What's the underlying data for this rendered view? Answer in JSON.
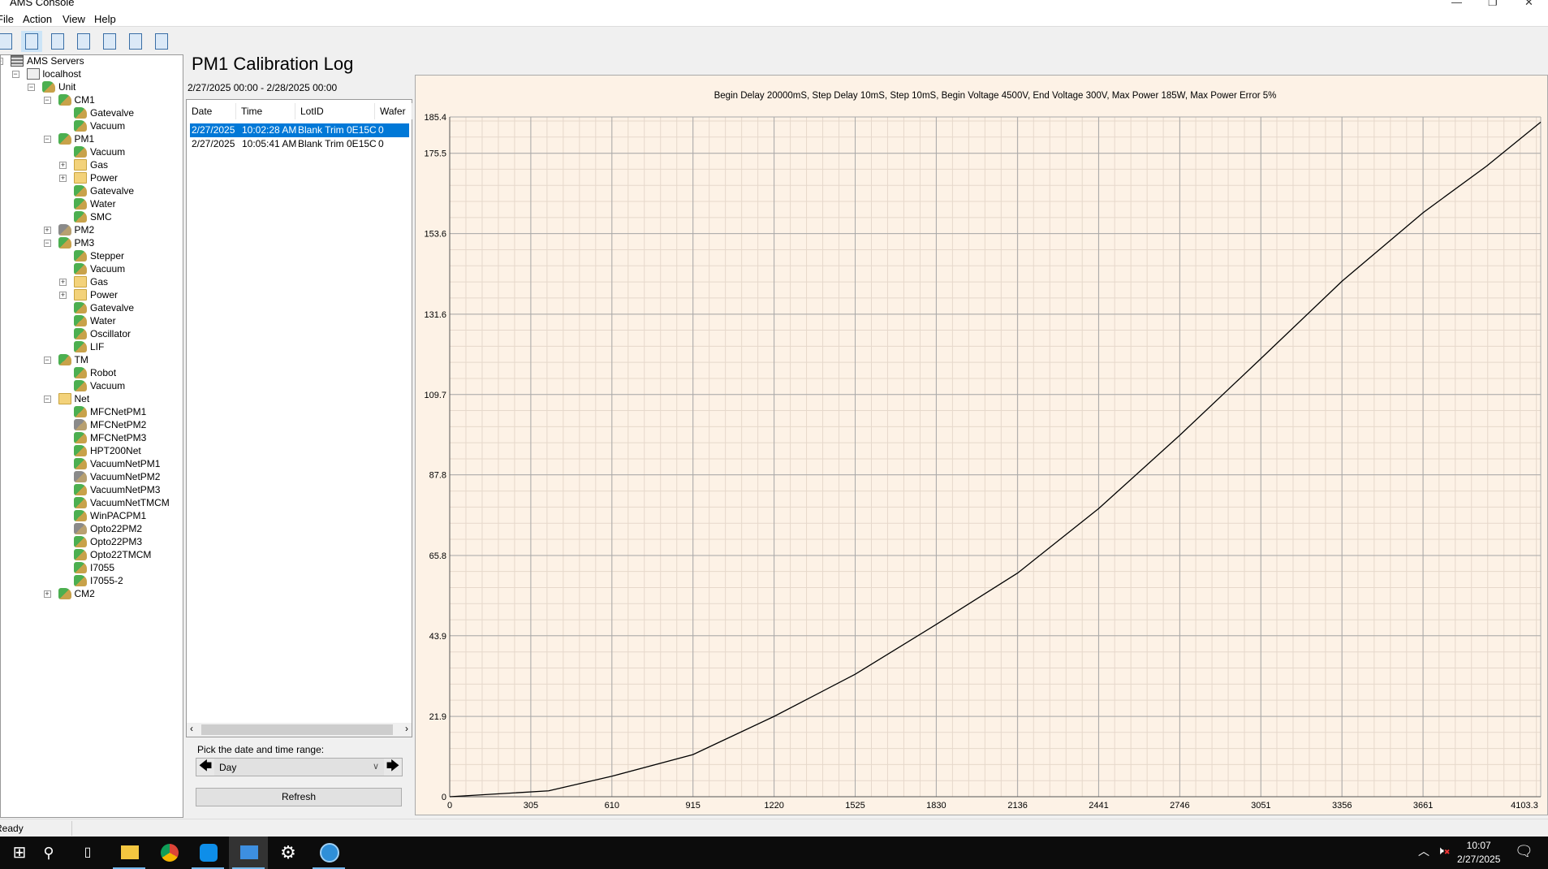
{
  "window": {
    "title": "AMS Console"
  },
  "menu": [
    "File",
    "Action",
    "View",
    "Help"
  ],
  "toolbar": [
    "alert-icon",
    "sync-icon",
    "check-icon",
    "help-info-icon",
    "document-icon",
    "edit-icon",
    "waveform-icon"
  ],
  "tree": [
    {
      "label": "AMS Servers",
      "level": 0,
      "icon": "server",
      "exp": "-"
    },
    {
      "label": "localhost",
      "level": 1,
      "icon": "host",
      "exp": "-"
    },
    {
      "label": "Unit",
      "level": 2,
      "icon": "dev",
      "exp": "-"
    },
    {
      "label": "CM1",
      "level": 3,
      "icon": "dev",
      "exp": "-"
    },
    {
      "label": "Gatevalve",
      "level": 4,
      "icon": "dev"
    },
    {
      "label": "Vacuum",
      "level": 4,
      "icon": "dev"
    },
    {
      "label": "PM1",
      "level": 3,
      "icon": "dev",
      "exp": "-"
    },
    {
      "label": "Vacuum",
      "level": 4,
      "icon": "dev"
    },
    {
      "label": "Gas",
      "level": 4,
      "icon": "folder",
      "exp": "+"
    },
    {
      "label": "Power",
      "level": 4,
      "icon": "folder",
      "exp": "+"
    },
    {
      "label": "Gatevalve",
      "level": 4,
      "icon": "dev"
    },
    {
      "label": "Water",
      "level": 4,
      "icon": "dev"
    },
    {
      "label": "SMC",
      "level": 4,
      "icon": "dev"
    },
    {
      "label": "PM2",
      "level": 3,
      "icon": "dev-gray",
      "exp": "+"
    },
    {
      "label": "PM3",
      "level": 3,
      "icon": "dev",
      "exp": "-"
    },
    {
      "label": "Stepper",
      "level": 4,
      "icon": "dev"
    },
    {
      "label": "Vacuum",
      "level": 4,
      "icon": "dev"
    },
    {
      "label": "Gas",
      "level": 4,
      "icon": "folder",
      "exp": "+"
    },
    {
      "label": "Power",
      "level": 4,
      "icon": "folder",
      "exp": "+"
    },
    {
      "label": "Gatevalve",
      "level": 4,
      "icon": "dev"
    },
    {
      "label": "Water",
      "level": 4,
      "icon": "dev"
    },
    {
      "label": "Oscillator",
      "level": 4,
      "icon": "dev"
    },
    {
      "label": "LIF",
      "level": 4,
      "icon": "dev"
    },
    {
      "label": "TM",
      "level": 3,
      "icon": "dev",
      "exp": "-"
    },
    {
      "label": "Robot",
      "level": 4,
      "icon": "dev"
    },
    {
      "label": "Vacuum",
      "level": 4,
      "icon": "dev"
    },
    {
      "label": "Net",
      "level": 3,
      "icon": "folder",
      "exp": "-"
    },
    {
      "label": "MFCNetPM1",
      "level": 4,
      "icon": "dev"
    },
    {
      "label": "MFCNetPM2",
      "level": 4,
      "icon": "dev-gray"
    },
    {
      "label": "MFCNetPM3",
      "level": 4,
      "icon": "dev"
    },
    {
      "label": "HPT200Net",
      "level": 4,
      "icon": "dev"
    },
    {
      "label": "VacuumNetPM1",
      "level": 4,
      "icon": "dev"
    },
    {
      "label": "VacuumNetPM2",
      "level": 4,
      "icon": "dev-gray"
    },
    {
      "label": "VacuumNetPM3",
      "level": 4,
      "icon": "dev"
    },
    {
      "label": "VacuumNetTMCM",
      "level": 4,
      "icon": "dev"
    },
    {
      "label": "WinPACPM1",
      "level": 4,
      "icon": "dev"
    },
    {
      "label": "Opto22PM2",
      "level": 4,
      "icon": "dev-gray"
    },
    {
      "label": "Opto22PM3",
      "level": 4,
      "icon": "dev"
    },
    {
      "label": "Opto22TMCM",
      "level": 4,
      "icon": "dev"
    },
    {
      "label": "I7055",
      "level": 4,
      "icon": "dev"
    },
    {
      "label": "I7055-2",
      "level": 4,
      "icon": "dev"
    },
    {
      "label": "CM2",
      "level": 3,
      "icon": "dev",
      "exp": "+"
    }
  ],
  "main": {
    "title": "PM1 Calibration Log",
    "date_range": "2/27/2025 00:00 - 2/28/2025 00:00",
    "columns": [
      "Date",
      "Time",
      "LotID",
      "Wafer"
    ],
    "rows": [
      [
        "2/27/2025",
        "10:02:28 AM",
        "Blank Trim 0E15C",
        "0"
      ],
      [
        "2/27/2025",
        "10:05:41 AM",
        "Blank Trim 0E15C",
        "0"
      ]
    ],
    "selected_row": 0,
    "pick_label": "Pick the date and time range:",
    "range_value": "Day",
    "refresh_label": "Refresh"
  },
  "chart_data": {
    "type": "line",
    "title": "Begin Delay 20000mS, Step Delay 10mS, Step 10mS, Begin Voltage 4500V, End Voltage 300V, Max Power 185W, Max Power Error 5%",
    "xlim": [
      0,
      4103.3
    ],
    "ylim": [
      0,
      185.4
    ],
    "xticks": [
      "0",
      "305",
      "610",
      "915",
      "1220",
      "1525",
      "1830",
      "2136",
      "2441",
      "2746",
      "3051",
      "3356",
      "3661",
      "4103.3"
    ],
    "yticks": [
      "0",
      "21.9",
      "43.9",
      "65.8",
      "87.8",
      "109.7",
      "131.6",
      "153.6",
      "175.5",
      "185.4"
    ],
    "grid": true,
    "line_color": "#000000",
    "background": "#fdf2e6",
    "x": [
      0,
      372,
      610,
      915,
      1220,
      1525,
      1830,
      2136,
      2441,
      2746,
      3051,
      3356,
      3661,
      3900,
      4103.3
    ],
    "y": [
      0,
      1.6,
      5.6,
      11.5,
      21.9,
      33.4,
      47,
      61,
      78.6,
      98.6,
      119.5,
      140.6,
      159.3,
      172,
      184
    ]
  },
  "status": {
    "text": "Ready"
  },
  "taskbar": {
    "time": "10:07",
    "date": "2/27/2025"
  }
}
